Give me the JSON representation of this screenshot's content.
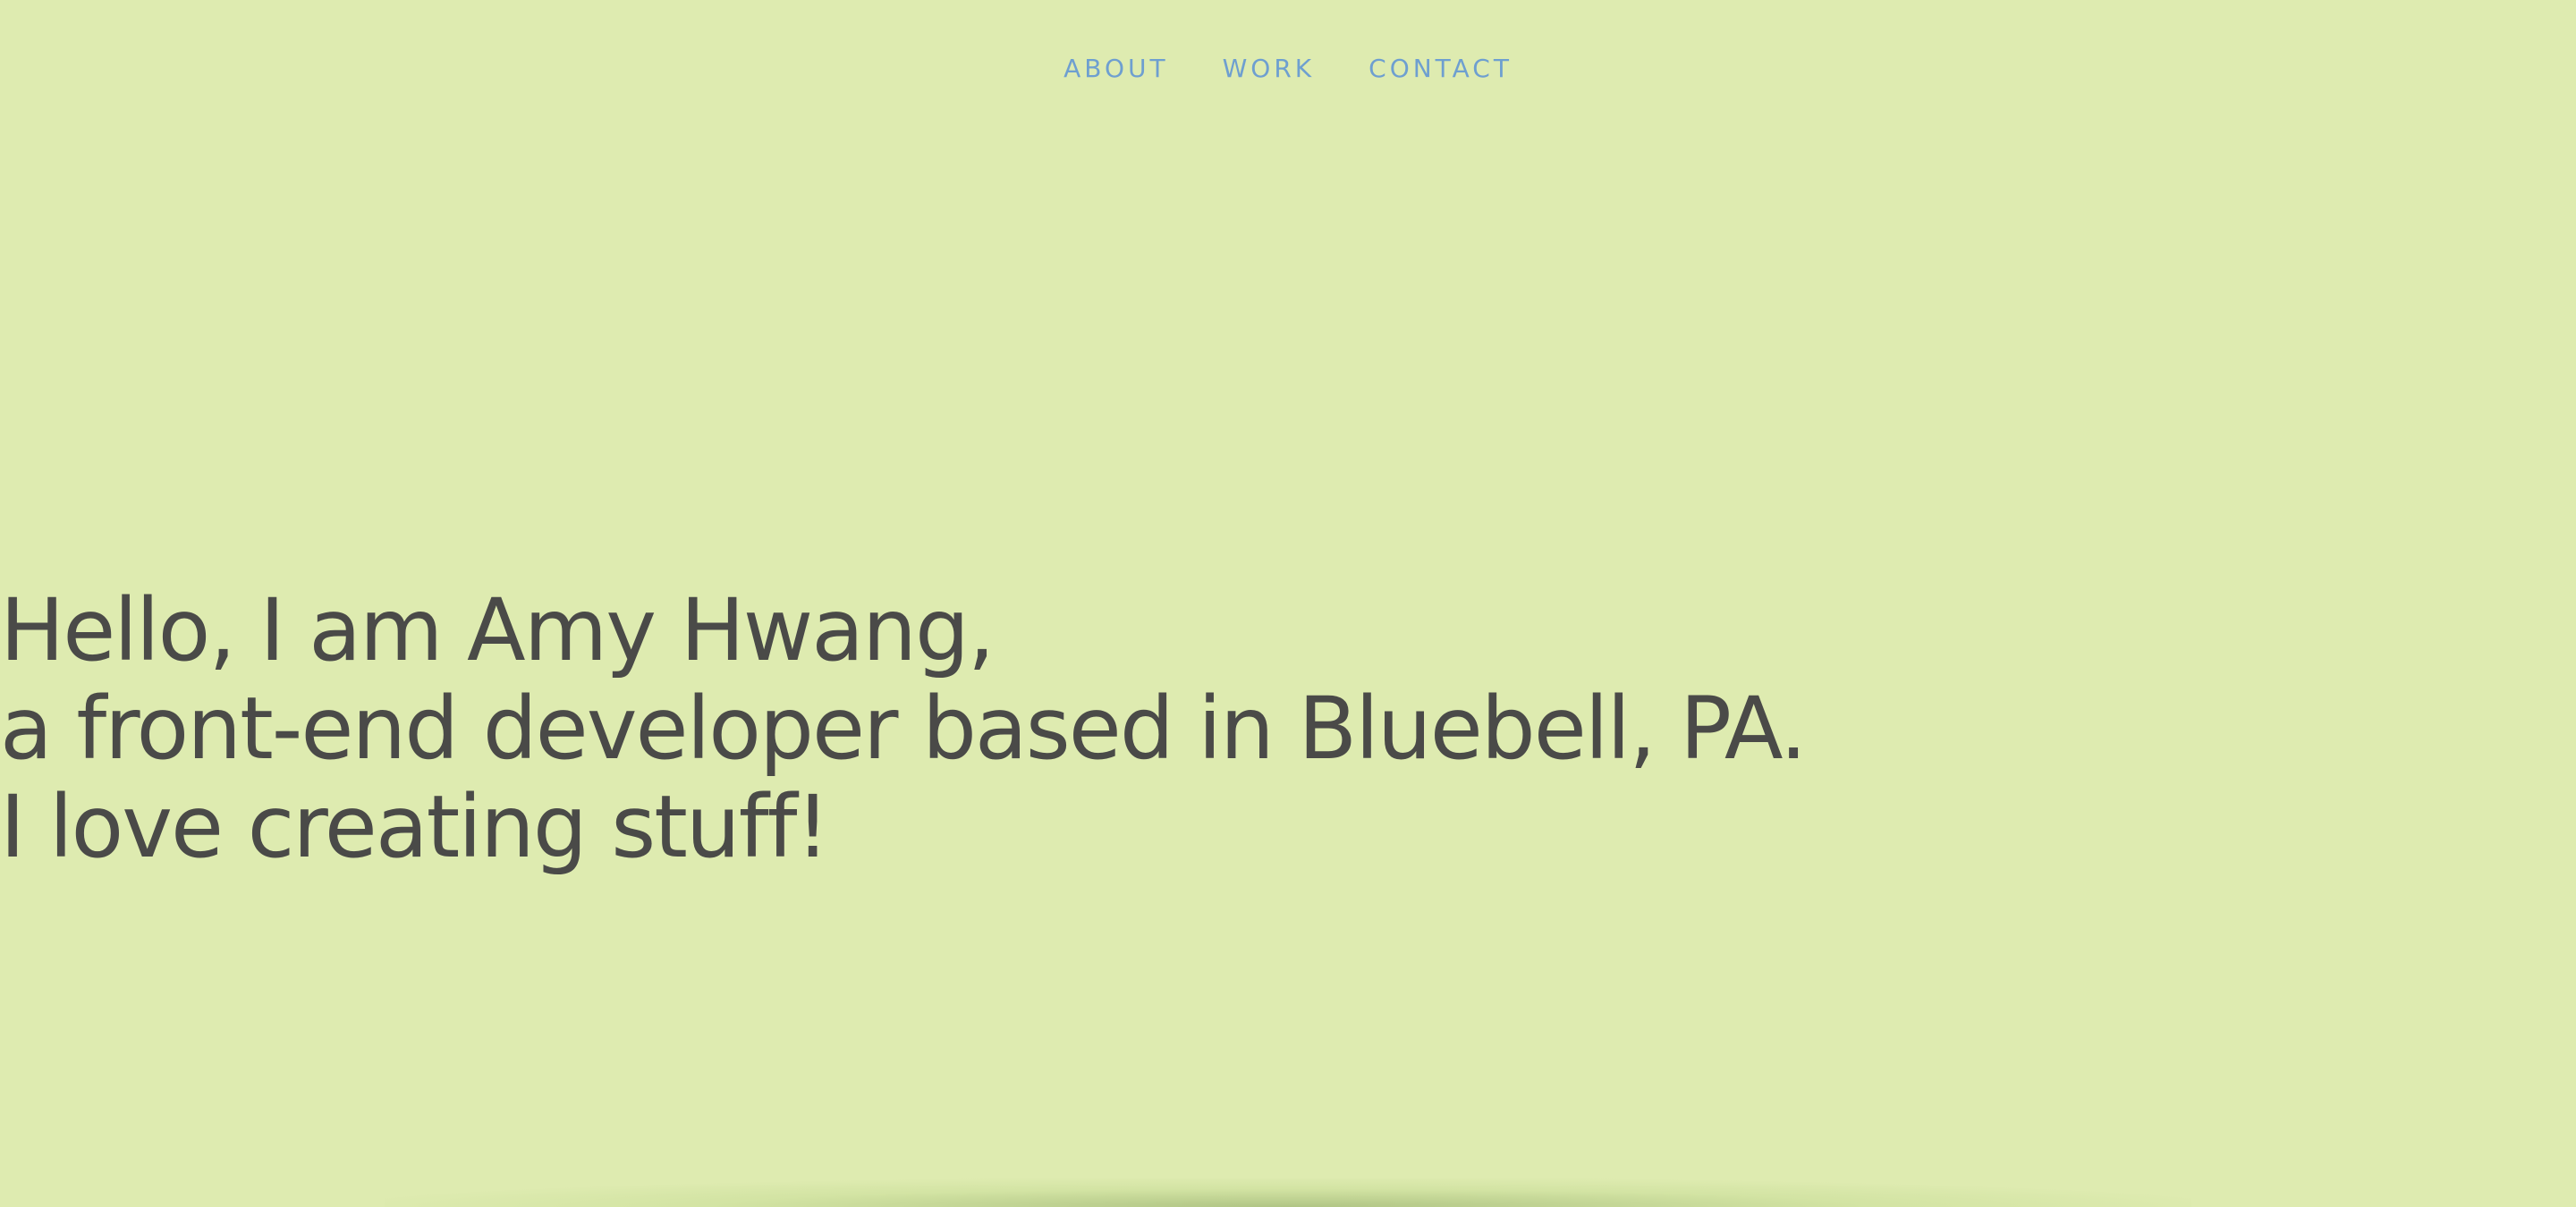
{
  "nav": {
    "items": [
      {
        "label": "ABOUT"
      },
      {
        "label": "WORK"
      },
      {
        "label": "CONTACT"
      }
    ]
  },
  "hero": {
    "line1": "Hello, I am Amy Hwang,",
    "line2": "a front-end developer based in Bluebell, PA.",
    "line3": "I love creating stuff!"
  },
  "colors": {
    "background": "#deebb0",
    "nav_link": "#6e9fd0",
    "text": "#4a4a48"
  }
}
